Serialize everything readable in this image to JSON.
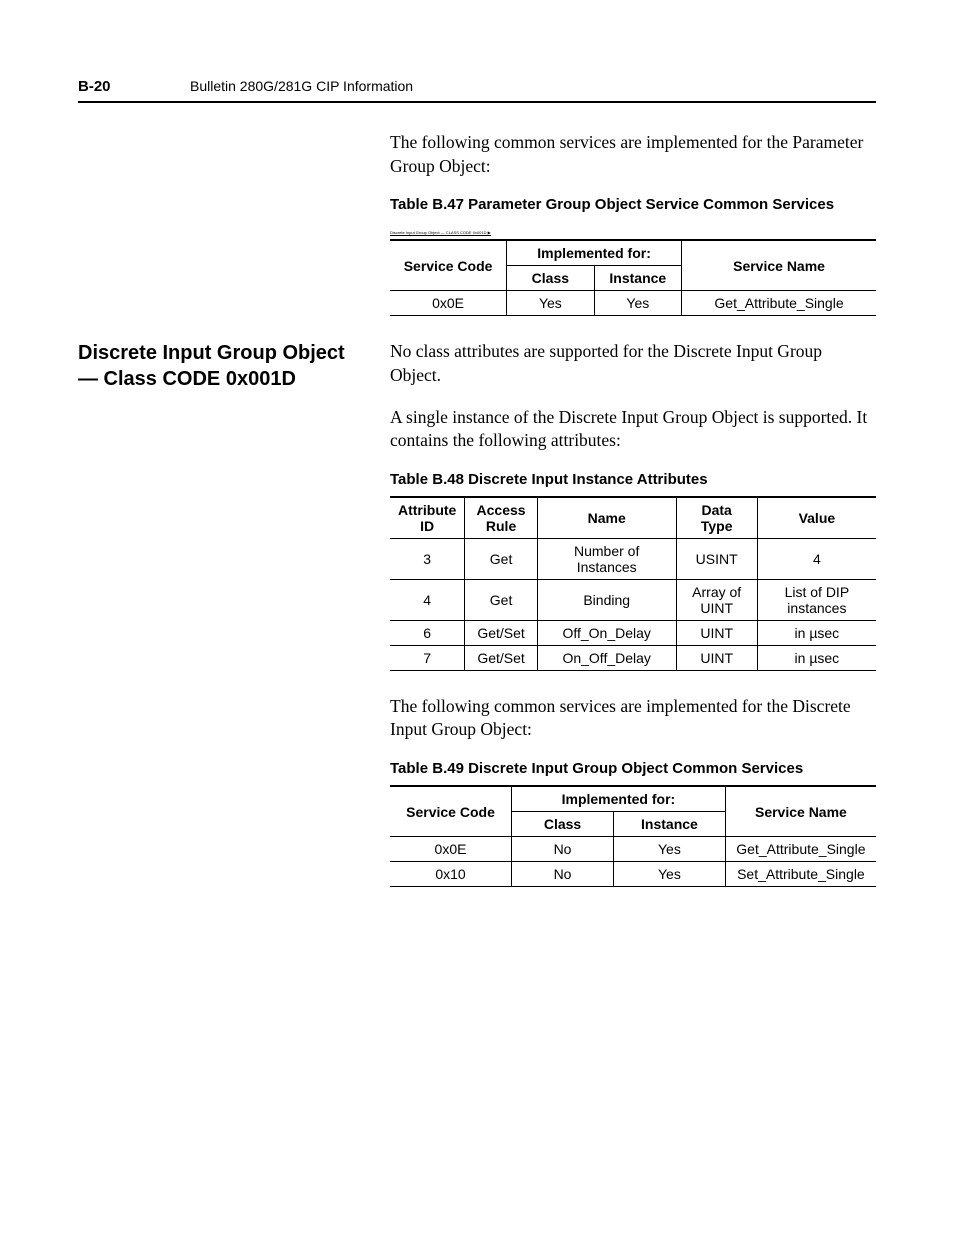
{
  "header": {
    "page_number": "B-20",
    "title": "Bulletin 280G/281G CIP Information"
  },
  "intro_text": "The following common services are implemented for the Parameter Group Object:",
  "tiny_hint": "Discrete Input Group Object — CLASS CODE 0x001D   ▶",
  "table47": {
    "caption": "Table B.47   Parameter Group Object Service Common Services",
    "head": {
      "service_code": "Service Code",
      "implemented_for": "Implemented for:",
      "class": "Class",
      "instance": "Instance",
      "service_name": "Service Name"
    },
    "rows": [
      {
        "code": "0x0E",
        "class": "Yes",
        "instance": "Yes",
        "name": "Get_Attribute_Single"
      }
    ]
  },
  "section": {
    "heading": "Discrete Input Group Object — Class CODE 0x001D",
    "para1": "No class attributes are supported for the Discrete Input Group Object.",
    "para2": "A single instance of the Discrete Input Group Object is supported. It contains the following attributes:"
  },
  "table48": {
    "caption": "Table B.48   Discrete Input Instance Attributes",
    "head": {
      "attribute_id": "Attribute ID",
      "access_rule": "Access Rule",
      "name": "Name",
      "data_type": "Data Type",
      "value": "Value"
    },
    "rows": [
      {
        "id": "3",
        "rule": "Get",
        "name": "Number of Instances",
        "type": "USINT",
        "value": "4"
      },
      {
        "id": "4",
        "rule": "Get",
        "name": "Binding",
        "type": "Array of UINT",
        "value": "List of DIP instances"
      },
      {
        "id": "6",
        "rule": "Get/Set",
        "name": "Off_On_Delay",
        "type": "UINT",
        "value": "in µsec"
      },
      {
        "id": "7",
        "rule": "Get/Set",
        "name": "On_Off_Delay",
        "type": "UINT",
        "value": "in µsec"
      }
    ]
  },
  "para3": "The following common services are implemented for the Discrete Input Group Object:",
  "table49": {
    "caption": "Table B.49   Discrete Input Group Object Common Services",
    "head": {
      "service_code": "Service Code",
      "implemented_for": "Implemented for:",
      "class": "Class",
      "instance": "Instance",
      "service_name": "Service Name"
    },
    "rows": [
      {
        "code": "0x0E",
        "class": "No",
        "instance": "Yes",
        "name": "Get_Attribute_Single"
      },
      {
        "code": "0x10",
        "class": "No",
        "instance": "Yes",
        "name": "Set_Attribute_Single"
      }
    ]
  }
}
